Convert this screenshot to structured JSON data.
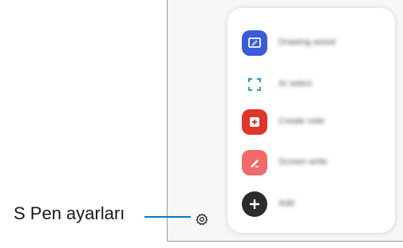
{
  "callout": {
    "label": "S Pen ayarları"
  },
  "air_command": {
    "items": [
      {
        "label": "Drawing assist",
        "icon": "drawing-assist-icon",
        "color": "#3d5ad8"
      },
      {
        "label": "AI select",
        "icon": "smart-select-icon",
        "color": "#2a8fd6"
      },
      {
        "label": "Create note",
        "icon": "create-note-icon",
        "color": "#e0352b"
      },
      {
        "label": "Screen write",
        "icon": "screen-write-icon",
        "color": "#f06a6a"
      },
      {
        "label": "Add",
        "icon": "add-icon",
        "color": "#2b2b2b"
      }
    ]
  },
  "colors": {
    "accent_line": "#0b78c8"
  }
}
